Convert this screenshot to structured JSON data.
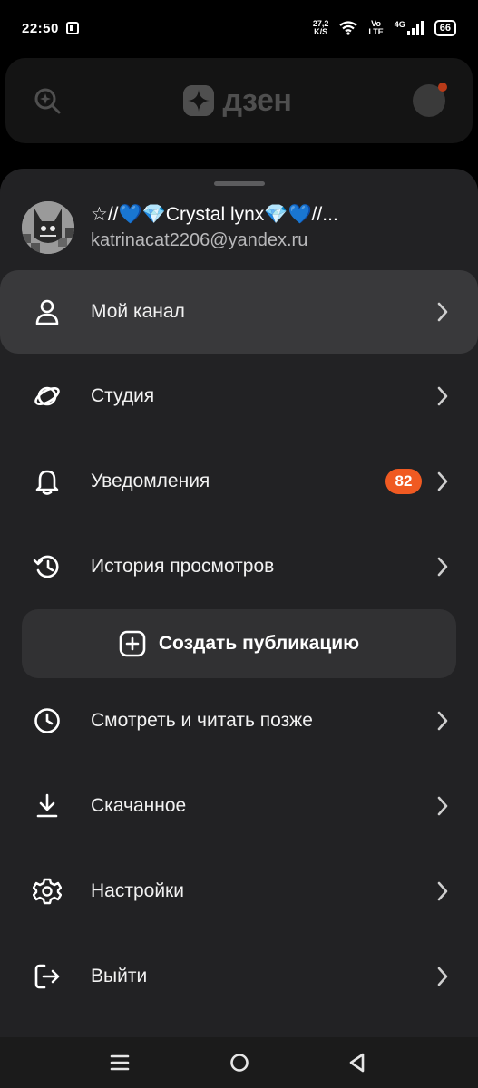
{
  "status_bar": {
    "time": "22:50",
    "net_speed_value": "27,2",
    "net_speed_unit": "K/S",
    "volte_top": "Vo",
    "volte_bottom": "LTE",
    "network": "4G",
    "battery": "66",
    "icons": [
      "app-notification-icon",
      "wifi-icon",
      "signal-icon",
      "battery-icon"
    ]
  },
  "header": {
    "logo_text": "дзен",
    "icons": [
      "search-icon",
      "zen-logo-icon",
      "avatar-icon"
    ]
  },
  "profile": {
    "name": "☆//💙💎Crystal lynx💎💙//...",
    "email": "katrinacat2206@yandex.ru"
  },
  "menu": {
    "items": [
      {
        "label": "Мой канал",
        "icon": "person-icon"
      },
      {
        "label": "Студия",
        "icon": "studio-icon"
      },
      {
        "label": "Уведомления",
        "icon": "bell-icon",
        "badge": "82"
      },
      {
        "label": "История просмотров",
        "icon": "history-icon"
      },
      {
        "label": "Смотреть и читать позже",
        "icon": "clock-icon"
      },
      {
        "label": "Скачанное",
        "icon": "download-icon"
      },
      {
        "label": "Настройки",
        "icon": "gear-icon"
      },
      {
        "label": "Выйти",
        "icon": "logout-icon"
      }
    ],
    "create_button": {
      "label": "Создать публикацию",
      "icon": "plus-square-icon"
    }
  },
  "colors": {
    "sheet_bg": "#222224",
    "active_row_bg": "#39393b",
    "badge": "#f05a22"
  },
  "nav_bar": {
    "icons": [
      "menu-icon",
      "home-icon",
      "back-icon"
    ]
  }
}
